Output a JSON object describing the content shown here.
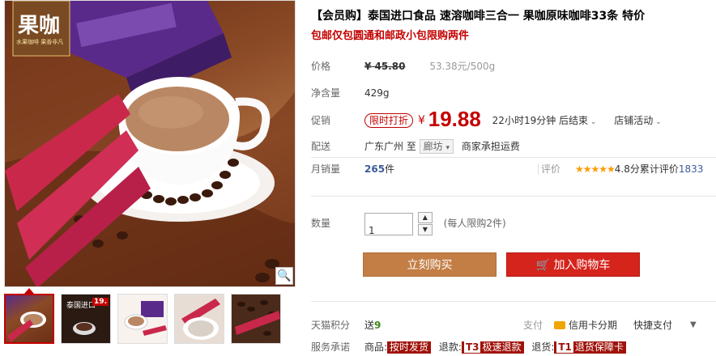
{
  "product": {
    "title": "【会员购】泰国进口食品 速溶咖啡三合一 果咖原味咖啡33条 特价",
    "subtitle": "包邮仅包圆通和邮政小包限购两件",
    "brand_text": "果咖",
    "brand_tagline": "水果咖啡 果香非凡"
  },
  "price": {
    "label": "价格",
    "original": "¥ 45.80",
    "unit_price": "53.38元/500g"
  },
  "net": {
    "label": "净含量",
    "value": "429g"
  },
  "promo": {
    "label": "促销",
    "tag": "限时打折",
    "currency": "¥",
    "price": "19.88",
    "countdown": "22小时19分钟 后结束",
    "store_activity": "店铺活动"
  },
  "shipping": {
    "label": "配送",
    "from": "广东广州 至",
    "to": "廊坊",
    "note": "商家承担运费"
  },
  "sales": {
    "label": "月销量",
    "count": "265",
    "unit": "件",
    "review_label": "评价",
    "stars": "★★★★★",
    "rating": "4.8分",
    "total_reviews_label": "累计评价",
    "total_reviews": "1833"
  },
  "quantity": {
    "label": "数量",
    "value": "1",
    "limit": "(每人限购2件)"
  },
  "buttons": {
    "buy_now": "立刻购买",
    "add_to_cart": "加入购物车"
  },
  "points": {
    "label": "天猫积分",
    "text": "送",
    "value": "9",
    "pay_label": "支付",
    "card": "信用卡分期",
    "quick": "快捷支付"
  },
  "service": {
    "label": "服务承诺",
    "goods_label": "商品:",
    "goods_tag": "按时发货",
    "refund_label": "退款:",
    "refund_code": "T3",
    "refund_tag": "极速退款",
    "return_label": "退货:",
    "return_code": "T1",
    "return_tag": "退货保障卡"
  },
  "thumb_badge": "19.",
  "thumb_caption": "泰国进口",
  "colors": {
    "accent_red": "#c40000",
    "buy_button": "#c37e45",
    "cart_button": "#d4241c"
  }
}
